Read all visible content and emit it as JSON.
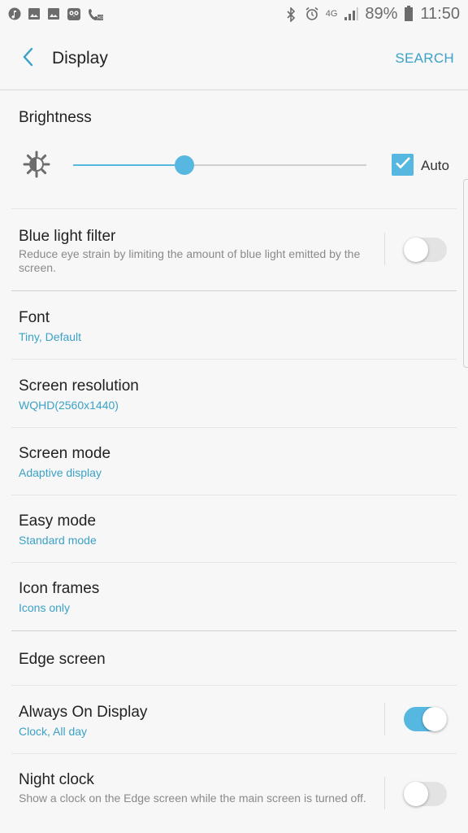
{
  "status_bar": {
    "left_icons": [
      "music-app-icon",
      "gallery-icon",
      "gallery-icon",
      "owl-app-icon",
      "call-hd-icon"
    ],
    "network_label": "4G",
    "battery": "89%",
    "time": "11:50"
  },
  "header": {
    "title": "Display",
    "search_label": "SEARCH"
  },
  "brightness": {
    "label": "Brightness",
    "level": 0.38,
    "auto_label": "Auto",
    "auto_checked": true
  },
  "items": {
    "blue_light": {
      "title": "Blue light filter",
      "desc": "Reduce eye strain by limiting the amount of blue light emitted by the screen.",
      "enabled": false
    },
    "font": {
      "title": "Font",
      "sub": "Tiny, Default"
    },
    "resolution": {
      "title": "Screen resolution",
      "sub": "WQHD(2560x1440)"
    },
    "mode": {
      "title": "Screen mode",
      "sub": "Adaptive display"
    },
    "easy": {
      "title": "Easy mode",
      "sub": "Standard mode"
    },
    "icon_frames": {
      "title": "Icon frames",
      "sub": "Icons only"
    },
    "edge": {
      "title": "Edge screen"
    },
    "aod": {
      "title": "Always On Display",
      "sub": "Clock, All day",
      "enabled": true
    },
    "night_clock": {
      "title": "Night clock",
      "desc": "Show a clock on the Edge screen while the main screen is turned off.",
      "enabled": false
    }
  },
  "colors": {
    "accent": "#3ba1c6",
    "toggle_on": "#56b8e0",
    "background": "#f7f7f7"
  }
}
